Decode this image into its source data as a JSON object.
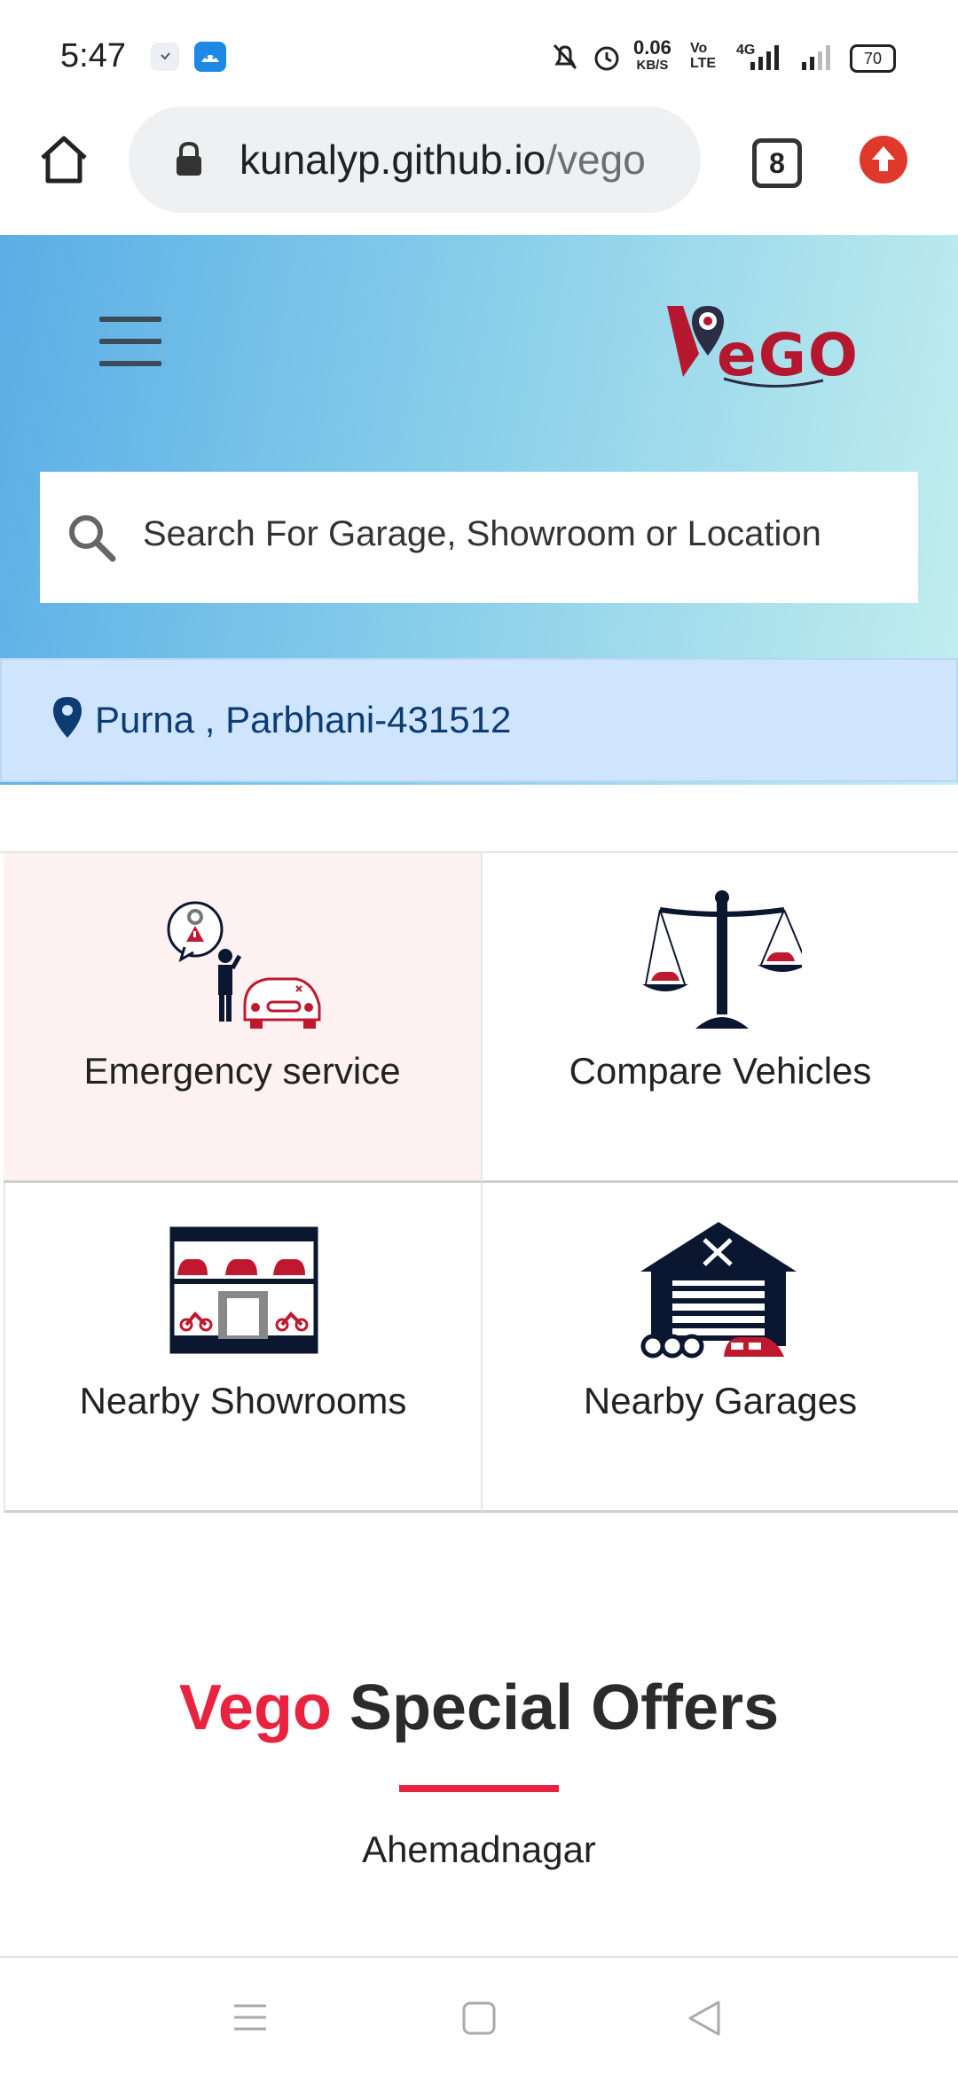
{
  "status_bar": {
    "time": "5:47",
    "net_speed": "0.06",
    "net_unit": "KB/S",
    "volte": "Vo LTE",
    "network": "4G",
    "battery": "70"
  },
  "browser": {
    "url_host": "kunalyp.github.io",
    "url_path": "/vego",
    "tab_count": "8"
  },
  "header": {
    "logo_text": "VeGO"
  },
  "search": {
    "placeholder": "Search For Garage, Showroom or Location"
  },
  "location": {
    "text": "Purna , Parbhani-431512"
  },
  "services": [
    {
      "label": "Emergency service",
      "icon": "emergency-service-icon"
    },
    {
      "label": "Compare Vehicles",
      "icon": "scale-icon"
    },
    {
      "label": "Nearby Showrooms",
      "icon": "showroom-icon"
    },
    {
      "label": "Nearby Garages",
      "icon": "garage-icon"
    }
  ],
  "offers": {
    "brand": "Vego",
    "title": "Special Offers",
    "city": "Ahemadnagar"
  },
  "colors": {
    "brand_red": "#e8233f",
    "location_bg": "#cfe5fd",
    "location_text": "#0d3c72",
    "icon_navy": "#0b1630",
    "icon_red": "#c0182f"
  }
}
